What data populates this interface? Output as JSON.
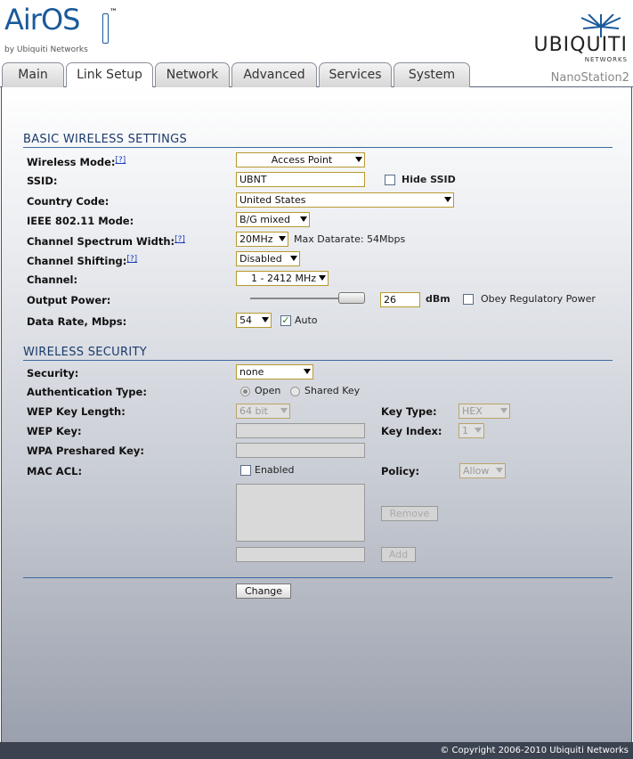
{
  "header": {
    "logo_text": "AirOS",
    "logo_tm": "™",
    "logo_by": "by Ubiquiti Networks",
    "brand": "UBIQUITI",
    "brand_sub": "NETWORKS",
    "device": "NanoStation2"
  },
  "tabs": [
    {
      "label": "Main",
      "active": false
    },
    {
      "label": "Link Setup",
      "active": true
    },
    {
      "label": "Network",
      "active": false
    },
    {
      "label": "Advanced",
      "active": false
    },
    {
      "label": "Services",
      "active": false
    },
    {
      "label": "System",
      "active": false
    }
  ],
  "basic": {
    "title": "BASIC WIRELESS SETTINGS",
    "help": "[?]",
    "wireless_mode_label": "Wireless Mode:",
    "wireless_mode": "Access Point",
    "ssid_label": "SSID:",
    "ssid": "UBNT",
    "hide_ssid": "Hide SSID",
    "country_label": "Country Code:",
    "country": "United States",
    "ieee_label": "IEEE 802.11 Mode:",
    "ieee": "B/G mixed",
    "spectrum_label": "Channel Spectrum Width:",
    "spectrum": "20MHz",
    "max_datarate": "Max Datarate: 54Mbps",
    "shifting_label": "Channel Shifting:",
    "shifting": "Disabled",
    "channel_label": "Channel:",
    "channel": "1 - 2412 MHz",
    "power_label": "Output Power:",
    "power": "26",
    "power_unit": "dBm",
    "obey": "Obey Regulatory Power",
    "datarate_label": "Data Rate, Mbps:",
    "datarate": "54",
    "auto": "Auto"
  },
  "security": {
    "title": "WIRELESS SECURITY",
    "security_label": "Security:",
    "security": "none",
    "auth_label": "Authentication Type:",
    "open": "Open",
    "shared": "Shared Key",
    "wep_len_label": "WEP Key Length:",
    "wep_len": "64 bit",
    "key_type_label": "Key Type:",
    "key_type": "HEX",
    "wep_key_label": "WEP Key:",
    "key_index_label": "Key Index:",
    "key_index": "1",
    "wpa_label": "WPA Preshared Key:",
    "mac_label": "MAC ACL:",
    "enabled": "Enabled",
    "policy_label": "Policy:",
    "policy": "Allow",
    "remove": "Remove",
    "add": "Add"
  },
  "change": "Change",
  "footer": "© Copyright 2006-2010 Ubiquiti Networks",
  "colors": {
    "section": "#1b3a6b",
    "rule": "#3e6aa0",
    "field_border": "#b89a2e",
    "footer_bg": "#3b4250"
  }
}
